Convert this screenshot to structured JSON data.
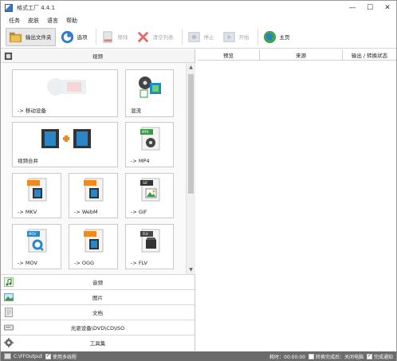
{
  "window": {
    "title": "格式工厂 4.4.1",
    "min_glyph": "—",
    "max_glyph": "☐",
    "close_glyph": "✕"
  },
  "menu": [
    "任务",
    "皮肤",
    "语言",
    "帮助"
  ],
  "toolbar": {
    "output_folder": "输出文件夹",
    "options": "选项",
    "remove": "移除",
    "clear_list": "清空列表",
    "stop": "停止",
    "start": "开始",
    "home": "主页"
  },
  "video_header": "视频",
  "tiles": {
    "mobile": "-> 移动设备",
    "mix": "混流",
    "merge": "视频合并",
    "mp4": "-> MP4",
    "mkv": "-> MKV",
    "webm": "-> WebM",
    "gif": "-> GIF",
    "mov": "-> MOV",
    "ogg": "-> OGG",
    "flv": "-> FLV",
    "mp4_badge": "MP4",
    "gif_badge": "GIF",
    "mov_badge": "MOV",
    "flv_badge": "FLV"
  },
  "categories": {
    "audio": "音频",
    "picture": "图片",
    "document": "文档",
    "optical": "光驱设备\\DVD\\CD\\ISO",
    "tools": "工具集"
  },
  "table": {
    "col_preview": "预览",
    "col_source": "来源",
    "col_output": "输出 / 转换状态"
  },
  "status": {
    "path": "C:\\FFOutput",
    "multithread": "使用多线程",
    "elapsed": "耗时：00:00:00",
    "after_convert": "转换完成后：关闭电脑",
    "notify": "完成通知"
  },
  "colors": {
    "accent": "#2a7bd4",
    "statusbar": "#6b6b6b"
  }
}
